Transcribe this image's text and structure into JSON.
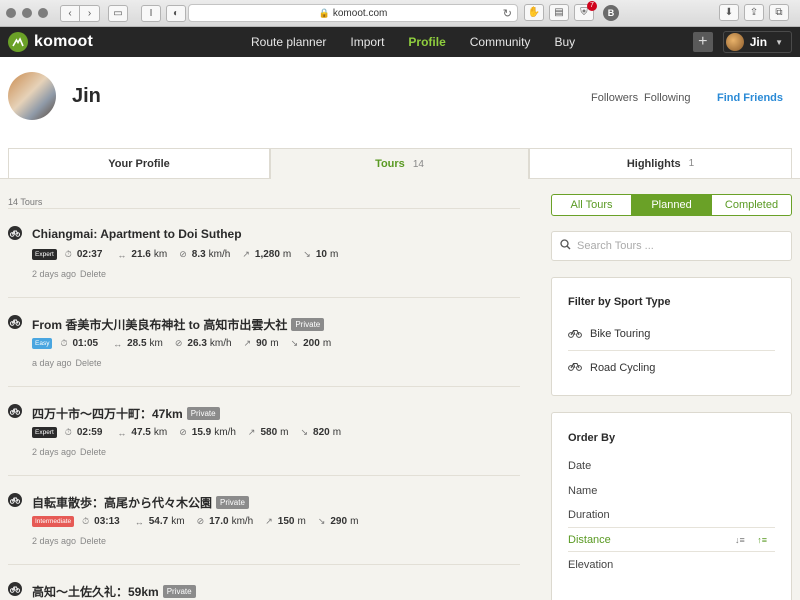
{
  "browser": {
    "url": "komoot.com",
    "badge_count": "7",
    "ext_letter": "B"
  },
  "topnav": {
    "brand": "komoot",
    "links": [
      "Route planner",
      "Import",
      "Profile",
      "Community",
      "Buy"
    ],
    "active": "Profile",
    "user": "Jin"
  },
  "profile": {
    "name": "Jin",
    "followers": "Followers",
    "following": "Following",
    "find_friends": "Find Friends"
  },
  "tabs": [
    {
      "label": "Your Profile",
      "count": ""
    },
    {
      "label": "Tours",
      "count": "14"
    },
    {
      "label": "Highlights",
      "count": "1"
    }
  ],
  "tours_count": "14 Tours",
  "tours": [
    {
      "title": "Chiangmai: Apartment to Doi Suthep",
      "private": "",
      "difficulty": "Expert",
      "duration": "02:37",
      "distance": "21.6",
      "distance_unit": "km",
      "speed": "8.3",
      "speed_unit": "km/h",
      "up": "1,280",
      "up_unit": "m",
      "down": "10",
      "down_unit": "m",
      "when": "2 days ago",
      "delete": "Delete"
    },
    {
      "title": "From 香美市大川美良布神社 to 高知市出雲大社",
      "private": "Private",
      "difficulty": "Easy",
      "duration": "01:05",
      "distance": "28.5",
      "distance_unit": "km",
      "speed": "26.3",
      "speed_unit": "km/h",
      "up": "90",
      "up_unit": "m",
      "down": "200",
      "down_unit": "m",
      "when": "a day ago",
      "delete": "Delete"
    },
    {
      "title": "四万十市〜四万十町：47km",
      "private": "Private",
      "difficulty": "Expert",
      "duration": "02:59",
      "distance": "47.5",
      "distance_unit": "km",
      "speed": "15.9",
      "speed_unit": "km/h",
      "up": "580",
      "up_unit": "m",
      "down": "820",
      "down_unit": "m",
      "when": "2 days ago",
      "delete": "Delete"
    },
    {
      "title": "自転車散歩：高尾から代々木公園",
      "private": "Private",
      "difficulty": "Intermediate",
      "duration": "03:13",
      "distance": "54.7",
      "distance_unit": "km",
      "speed": "17.0",
      "speed_unit": "km/h",
      "up": "150",
      "up_unit": "m",
      "down": "290",
      "down_unit": "m",
      "when": "2 days ago",
      "delete": "Delete"
    },
    {
      "title": "高知〜土佐久礼：59km",
      "private": "Private"
    }
  ],
  "segments": [
    "All Tours",
    "Planned",
    "Completed"
  ],
  "segment_active": "Planned",
  "search": {
    "placeholder": "Search Tours ..."
  },
  "filter": {
    "title": "Filter by Sport Type",
    "items": [
      "Bike Touring",
      "Road Cycling"
    ]
  },
  "order": {
    "title": "Order By",
    "items": [
      "Date",
      "Name",
      "Duration",
      "Distance",
      "Elevation"
    ],
    "active": "Distance"
  },
  "colors": {
    "brand_green": "#6aa127",
    "nav_bg": "#262626",
    "link_blue": "#2a8ad6",
    "page_bg": "#f4f3ee"
  }
}
